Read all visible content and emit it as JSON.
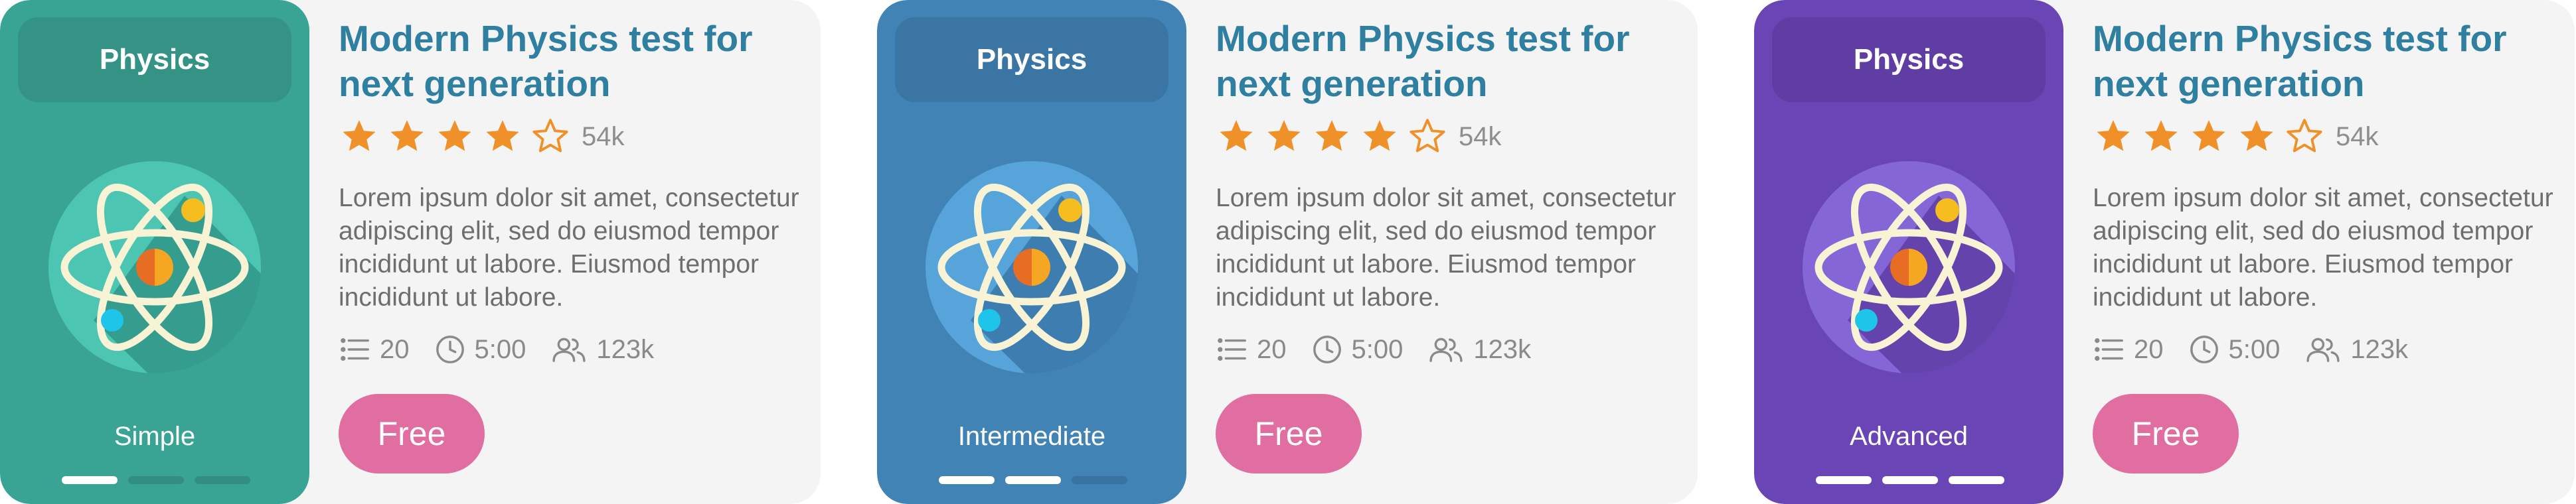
{
  "colors": {
    "title": "#2f7fa0",
    "star": "#ef9128",
    "button": "#e06ea0",
    "card_bg": "#f4f4f4"
  },
  "cards": [
    {
      "subject": "Physics",
      "level": "Simple",
      "theme": {
        "side": "#3aa494",
        "circle": "#4cc6b2",
        "shadow": "#2d8f80"
      },
      "dots_active": 1,
      "title": "Modern Physics test for next generation",
      "rating": 4,
      "rating_count": "54k",
      "description": "Lorem ipsum dolor sit amet, consectetur adipiscing elit, sed do eiusmod tempor incididunt ut labore. Eiusmod tempor incididunt ut labore.",
      "questions": "20",
      "duration": "5:00",
      "participants": "123k",
      "price_label": "Free"
    },
    {
      "subject": "Physics",
      "level": "Intermediate",
      "theme": {
        "side": "#4283b6",
        "circle": "#56a4da",
        "shadow": "#3670a0"
      },
      "dots_active": 2,
      "title": "Modern Physics test for next generation",
      "rating": 4,
      "rating_count": "54k",
      "description": "Lorem ipsum dolor sit amet, consectetur adipiscing elit, sed do eiusmod tempor incididunt ut labore. Eiusmod tempor incididunt ut labore.",
      "questions": "20",
      "duration": "5:00",
      "participants": "123k",
      "price_label": "Free"
    },
    {
      "subject": "Physics",
      "level": "Advanced",
      "theme": {
        "side": "#6a45b6",
        "circle": "#8466d6",
        "shadow": "#5a389e"
      },
      "dots_active": 3,
      "title": "Modern Physics test for next generation",
      "rating": 4,
      "rating_count": "54k",
      "description": "Lorem ipsum dolor sit amet, consectetur adipiscing elit, sed do eiusmod tempor incididunt ut labore. Eiusmod tempor incididunt ut labore.",
      "questions": "20",
      "duration": "5:00",
      "participants": "123k",
      "price_label": "Free"
    }
  ]
}
